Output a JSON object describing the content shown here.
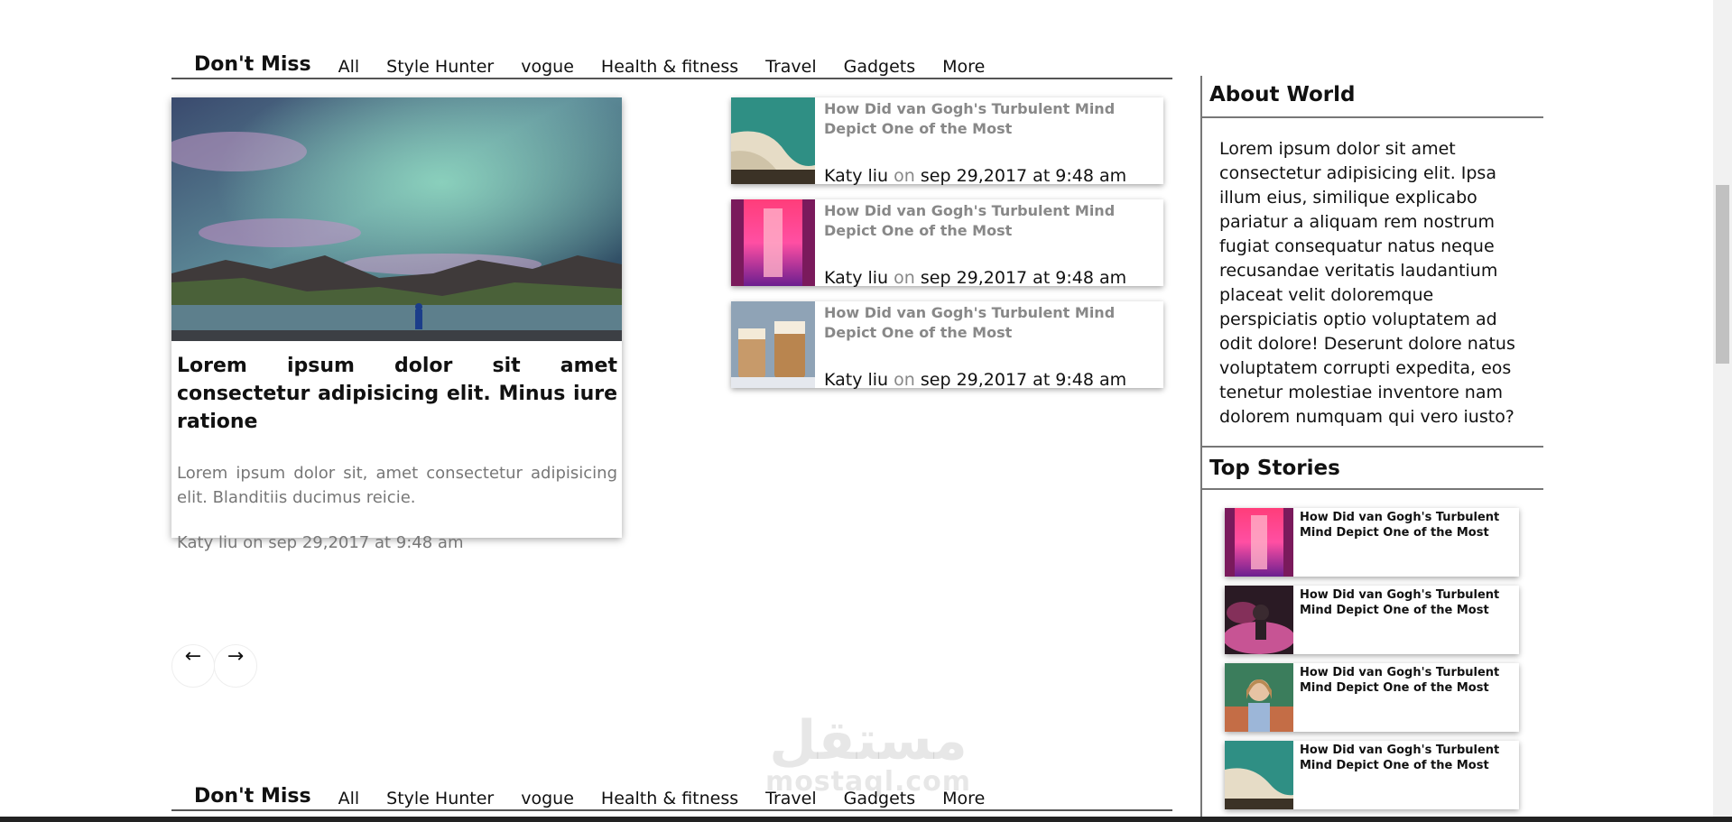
{
  "nav": {
    "title": "Don't Miss",
    "tabs": [
      "All",
      "Style Hunter",
      "vogue",
      "Health & fitness",
      "Travel",
      "Gadgets",
      "More"
    ]
  },
  "featured": {
    "image": "aurora-landscape-image",
    "title": "Lorem ipsum dolor sit amet consectetur adipisicing elit. Minus iure ratione",
    "excerpt": "Lorem ipsum dolor sit, amet consectetur adipisicing elit. Blanditiis ducimus reicie.",
    "meta": "Katy liu on sep 29,2017 at 9:48 am"
  },
  "side_articles": [
    {
      "title": "How Did van Gogh's Turbulent Mind Depict One of the Most",
      "author": "Katy liu",
      "on": "on",
      "date": "sep 29,2017 at 9:48 am",
      "image": "beach-aerial-image"
    },
    {
      "title": "How Did van Gogh's Turbulent Mind Depict One of the Most",
      "author": "Katy liu",
      "on": "on",
      "date": "sep 29,2017 at 9:48 am",
      "image": "neon-corridor-image"
    },
    {
      "title": "How Did van Gogh's Turbulent Mind Depict One of the Most",
      "author": "Katy liu",
      "on": "on",
      "date": "sep 29,2017 at 9:48 am",
      "image": "dessert-jars-image"
    }
  ],
  "arrows": {
    "prev": "←",
    "next": "→"
  },
  "sidebar": {
    "about_title": "About World",
    "about_text": "Lorem ipsum dolor sit amet consectetur adipisicing elit. Ipsa illum eius, similique explicabo pariatur a aliquam rem nostrum fugiat consequatur natus neque recusandae veritatis laudantium placeat velit doloremque perspiciatis optio voluptatem ad odit dolore! Deserunt dolore natus voluptatem corrupti expedita, eos tenetur molestiae inventore nam dolorem numquam qui vero iusto?",
    "top_title": "Top Stories",
    "stories": [
      {
        "title": "How Did van Gogh's Turbulent Mind Depict One of the Most",
        "image": "neon-corridor-image"
      },
      {
        "title": "How Did van Gogh's Turbulent Mind Depict One of the Most",
        "image": "pink-smoke-portrait-image"
      },
      {
        "title": "How Did van Gogh's Turbulent Mind Depict One of the Most",
        "image": "woman-portrait-image"
      },
      {
        "title": "How Did van Gogh's Turbulent Mind Depict One of the Most",
        "image": "beach-aerial-image"
      }
    ]
  },
  "watermark": {
    "arabic": "مستقل",
    "latin": "mostaql.com"
  }
}
